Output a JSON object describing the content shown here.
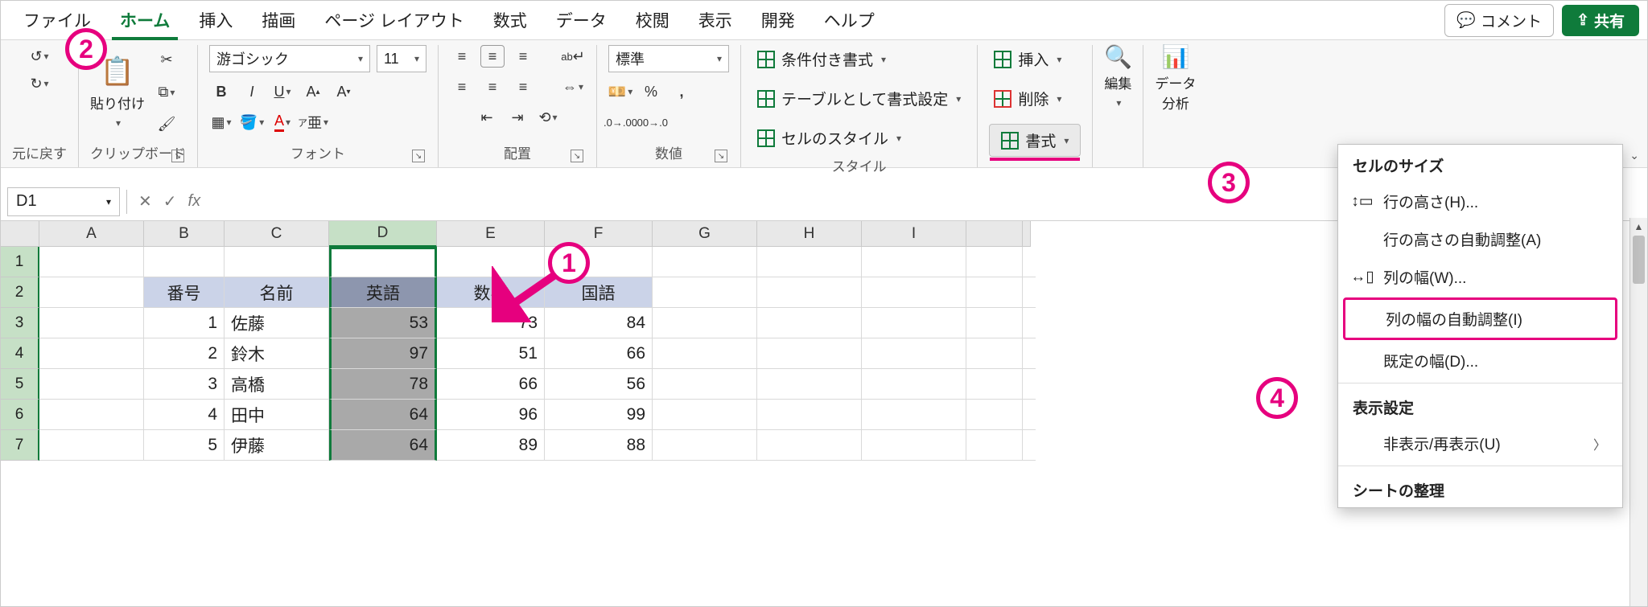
{
  "tabs": {
    "file": "ファイル",
    "home": "ホーム",
    "insert": "挿入",
    "draw": "描画",
    "layout": "ページ レイアウト",
    "formulas": "数式",
    "data": "データ",
    "review": "校閲",
    "view": "表示",
    "developer": "開発",
    "help": "ヘルプ"
  },
  "topButtons": {
    "comment": "コメント",
    "share": "共有"
  },
  "ribbon": {
    "undoGroup": "元に戻す",
    "clipboard": {
      "paste": "貼り付け",
      "label": "クリップボード"
    },
    "font": {
      "name": "游ゴシック",
      "size": "11",
      "bold": "B",
      "italic": "I",
      "underline": "U",
      "label": "フォント",
      "ruby": "ア",
      "rubySmall": "亜"
    },
    "align": {
      "label": "配置",
      "wrap": "ab"
    },
    "number": {
      "format": "標準",
      "label": "数値",
      "percent": "%",
      "comma": ","
    },
    "styles": {
      "cond": "条件付き書式",
      "table": "テーブルとして書式設定",
      "cell": "セルのスタイル",
      "label": "スタイル"
    },
    "cells": {
      "insert": "挿入",
      "delete": "削除",
      "format": "書式"
    },
    "editing": "編集",
    "analysis": "データ\n分析"
  },
  "formulaBar": {
    "name": "D1",
    "fx": "fx"
  },
  "columns": [
    "A",
    "B",
    "C",
    "D",
    "E",
    "F",
    "G",
    "H",
    "I"
  ],
  "rows": [
    "1",
    "2",
    "3",
    "4",
    "5",
    "6",
    "7"
  ],
  "table": {
    "headers": {
      "num": "番号",
      "name": "名前",
      "eng": "英語",
      "math": "数学",
      "jp": "国語"
    },
    "data": [
      {
        "num": 1,
        "name": "佐藤",
        "eng": 53,
        "math": 73,
        "jp": 84
      },
      {
        "num": 2,
        "name": "鈴木",
        "eng": 97,
        "math": 51,
        "jp": 66
      },
      {
        "num": 3,
        "name": "高橋",
        "eng": 78,
        "math": 66,
        "jp": 56
      },
      {
        "num": 4,
        "name": "田中",
        "eng": 64,
        "math": 96,
        "jp": 99
      },
      {
        "num": 5,
        "name": "伊藤",
        "eng": 64,
        "math": 89,
        "jp": 88
      }
    ]
  },
  "menu": {
    "sizeHdr": "セルのサイズ",
    "rowHeight": "行の高さ(H)...",
    "autoRowHeight": "行の高さの自動調整(A)",
    "colWidth": "列の幅(W)...",
    "autoColWidth": "列の幅の自動調整(I)",
    "defaultWidth": "既定の幅(D)...",
    "visHdr": "表示設定",
    "hideUnhide": "非表示/再表示(U)",
    "sheetHdr": "シートの整理"
  },
  "callouts": {
    "c1": "1",
    "c2": "2",
    "c3": "3",
    "c4": "4"
  }
}
